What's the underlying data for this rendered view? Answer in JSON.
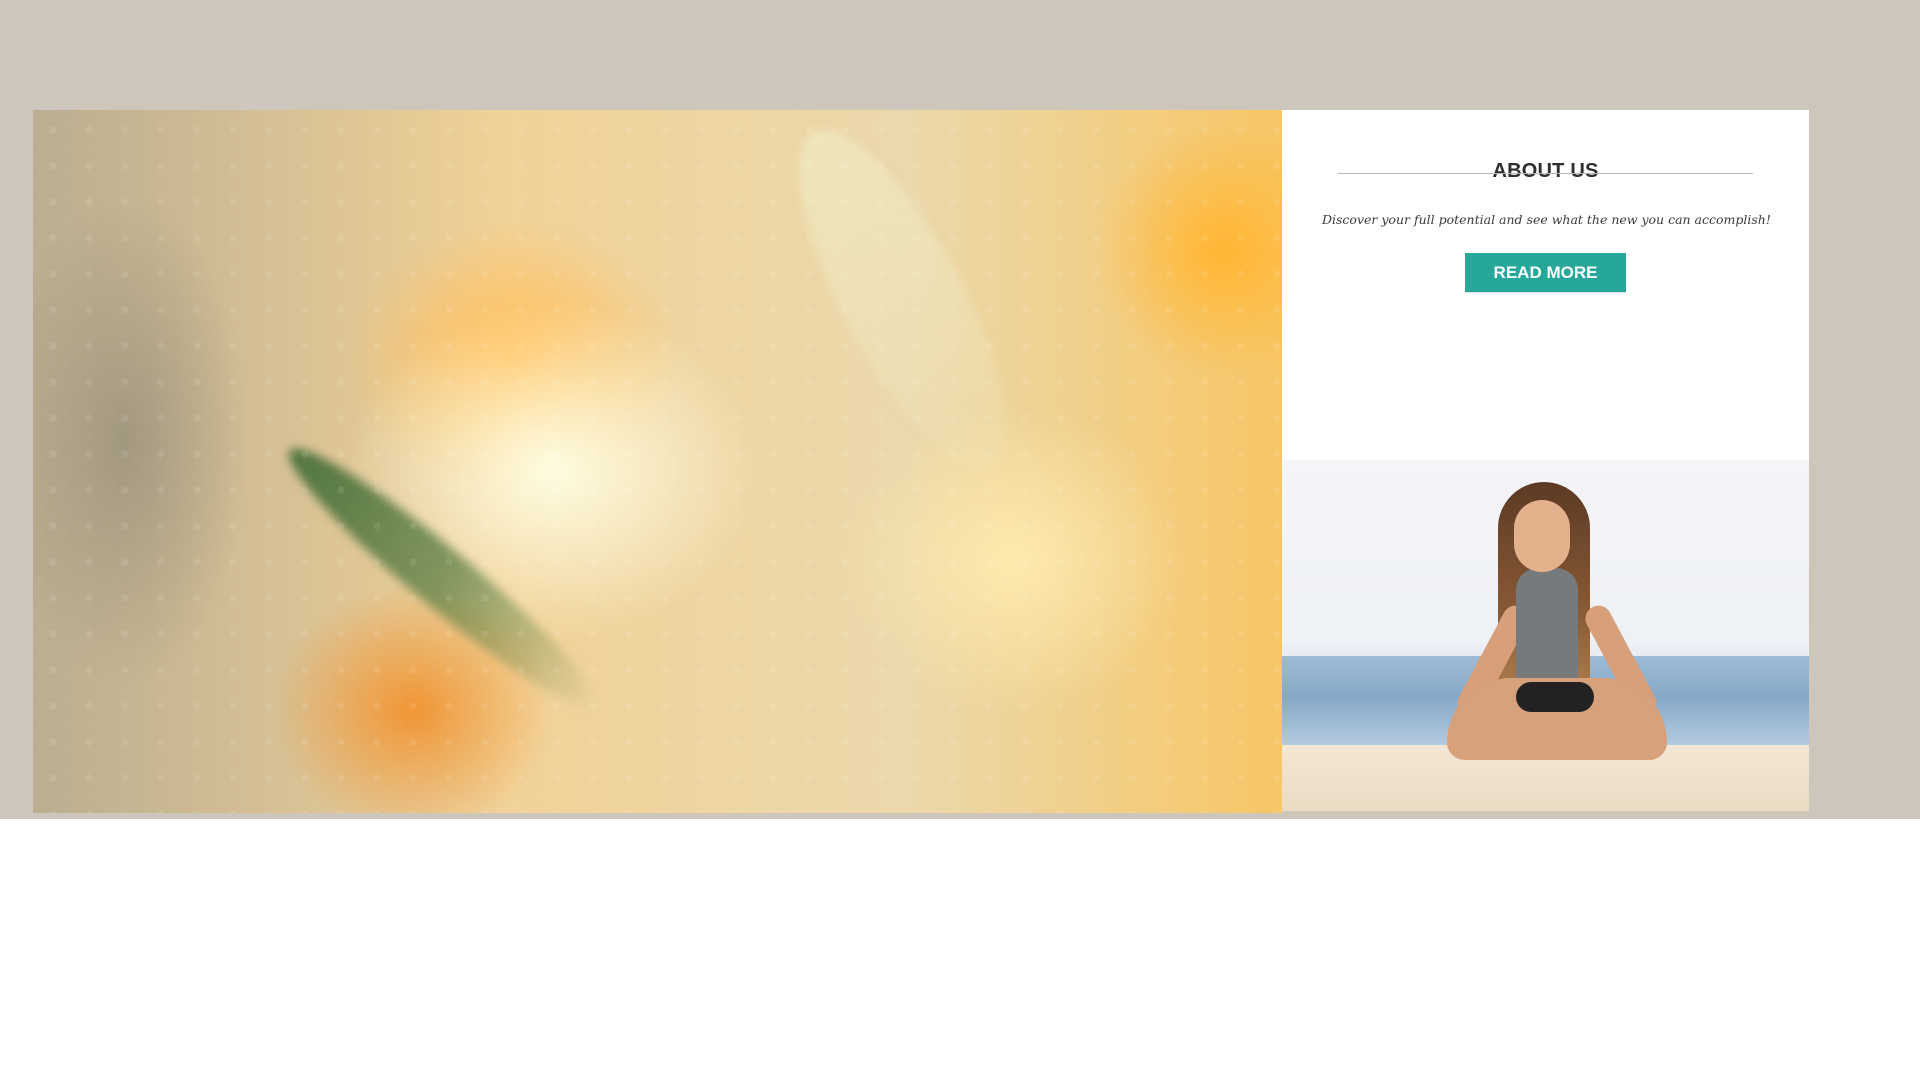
{
  "about": {
    "title": "ABOUT US",
    "tagline": "Discover your full potential and see what the new you can accomplish!",
    "button_label": "READ MORE"
  },
  "colors": {
    "background_band": "#cdc6bb",
    "button": "#27a69a",
    "card": "#ffffff"
  }
}
